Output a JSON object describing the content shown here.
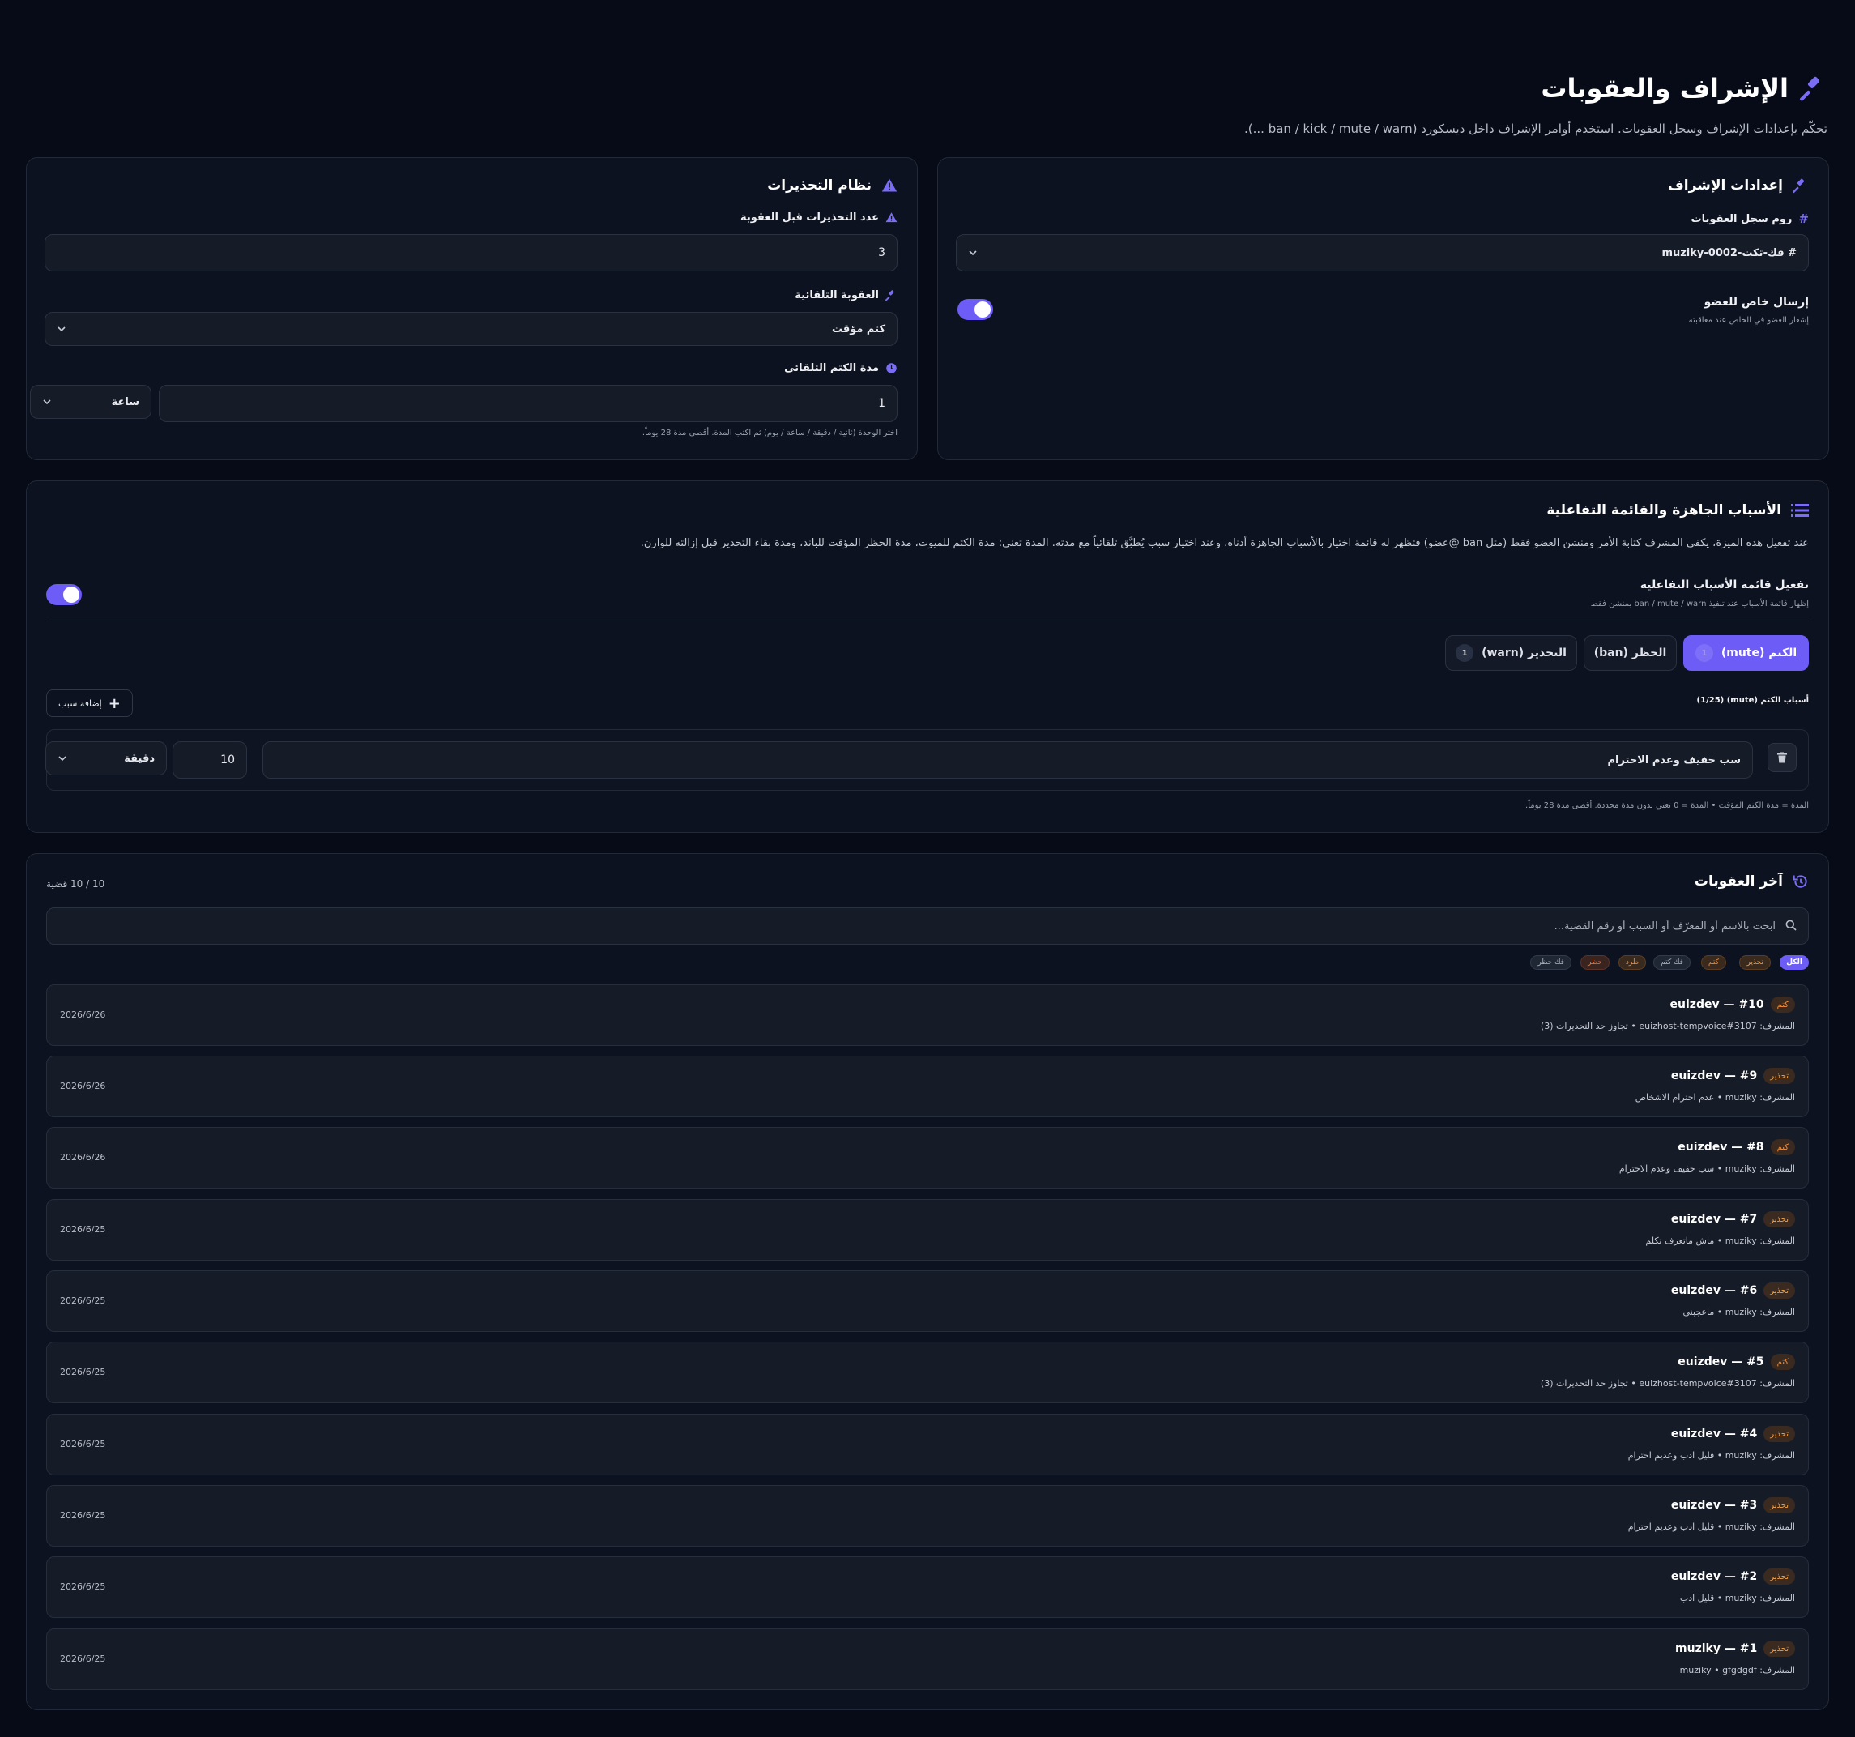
{
  "header": {
    "title": "الإشراف والعقوبات",
    "subtitle": "تحكّم بإعدادات الإشراف وسجل العقوبات. استخدم أوامر الإشراف داخل ديسكورد (ban / kick / mute / warn ...)."
  },
  "moderation_settings": {
    "title": "إعدادات الإشراف",
    "log_channel_label": "روم سجل العقوبات",
    "log_channel_value": "# فك-تكت-muziky-0002",
    "dm_title": "إرسال خاص للعضو",
    "dm_desc": "إشعار العضو في الخاص عند معاقبته",
    "dm_enabled": true
  },
  "warnings": {
    "title": "نظام التحذيرات",
    "count_label": "عدد التحذيرات قبل العقوبة",
    "count_value": "3",
    "auto_punish_label": "العقوبة التلقائية",
    "auto_punish_value": "كتم مؤقت",
    "auto_mute_label": "مدة الكتم التلقائي",
    "auto_mute_value": "1",
    "auto_mute_unit": "ساعة",
    "auto_mute_hint": "اختر الوحدة (ثانية / دقيقة / ساعة / يوم) ثم اكتب المدة. أقصى مدة 28 يوماً."
  },
  "reasons": {
    "title": "الأسباب الجاهزة والقائمة التفاعلية",
    "desc": "عند تفعيل هذه الميزة، يكفي المشرف كتابة الأمر ومنشن العضو فقط (مثل ban @عضو) فتظهر له قائمة اختيار بالأسباب الجاهزة أدناه، وعند اختيار سبب يُطبَّق تلقائياً مع مدته. المدة تعني: مدة الكتم للميوت، مدة الحظر المؤقت للباند، ومدة بقاء التحذير قبل إزالته للوارن.",
    "toggle_title": "تفعيل قائمة الأسباب التفاعلية",
    "toggle_desc": "إظهار قائمة الأسباب عند تنفيذ ban / mute / warn بمنشن فقط",
    "toggle_enabled": true,
    "tabs": [
      {
        "label": "الكتم (mute)",
        "count": "1"
      },
      {
        "label": "الحظر (ban)",
        "count": ""
      },
      {
        "label": "التحذير (warn)",
        "count": "1"
      }
    ],
    "list_label": "أسباب الكتم (mute) (1/25)",
    "add_button": "إضافة سبب",
    "reason_text": "سب خفيف وعدم الاحترام",
    "reason_duration": "10",
    "reason_unit": "دقيقة",
    "footer_hint": "المدة = مدة الكتم المؤقت • المدة = 0 تعني بدون مدة محددة. أقصى مدة 28 يوماً."
  },
  "recent": {
    "title": "آخر العقوبات",
    "count": "10 / 10 قضية",
    "search_placeholder": "ابحث بالاسم أو المعرّف أو السبب أو رقم القضية...",
    "filters": [
      "الكل",
      "تحذير",
      "كتم",
      "فك كتم",
      "طرد",
      "حظر",
      "فك حظر"
    ],
    "cases": [
      {
        "id": "euizdev — #10",
        "type": "كتم",
        "kind": "mute",
        "meta": "المشرف: euizhost-tempvoice#3107 • تجاوز حد التحذيرات (3)",
        "date": "2026/6/26"
      },
      {
        "id": "euizdev — #9",
        "type": "تحذير",
        "kind": "warn",
        "meta": "المشرف: muziky • عدم احترام الاشخاص",
        "date": "2026/6/26"
      },
      {
        "id": "euizdev — #8",
        "type": "كتم",
        "kind": "mute",
        "meta": "المشرف: muziky • سب خفيف وعدم الاحترام",
        "date": "2026/6/26"
      },
      {
        "id": "euizdev — #7",
        "type": "تحذير",
        "kind": "warn",
        "meta": "المشرف: muziky • ماش ماتعرف تكلم",
        "date": "2026/6/25"
      },
      {
        "id": "euizdev — #6",
        "type": "تحذير",
        "kind": "warn",
        "meta": "المشرف: muziky • ماعجبني",
        "date": "2026/6/25"
      },
      {
        "id": "euizdev — #5",
        "type": "كتم",
        "kind": "mute",
        "meta": "المشرف: euizhost-tempvoice#3107 • تجاوز حد التحذيرات (3)",
        "date": "2026/6/25"
      },
      {
        "id": "euizdev — #4",
        "type": "تحذير",
        "kind": "warn",
        "meta": "المشرف: muziky • قليل ادب وعديم احترام",
        "date": "2026/6/25"
      },
      {
        "id": "euizdev — #3",
        "type": "تحذير",
        "kind": "warn",
        "meta": "المشرف: muziky • قليل ادب وعديم احترام",
        "date": "2026/6/25"
      },
      {
        "id": "euizdev — #2",
        "type": "تحذير",
        "kind": "warn",
        "meta": "المشرف: muziky • قليل ادب",
        "date": "2026/6/25"
      },
      {
        "id": "muziky — #1",
        "type": "تحذير",
        "kind": "warn",
        "meta": "المشرف: muziky • gfgdgdf",
        "date": "2026/6/25"
      }
    ]
  },
  "colors": {
    "accent": "#6d5cf5",
    "background": "#060b17",
    "card": "#0c121f",
    "badge_text": "#f0a24a"
  }
}
